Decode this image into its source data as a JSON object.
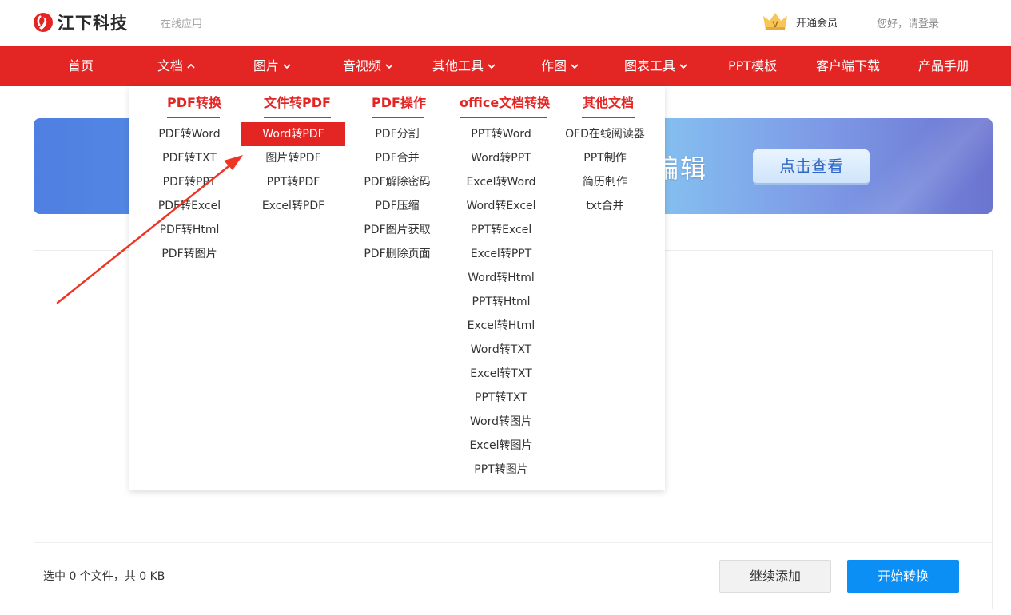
{
  "header": {
    "logo_text": "江下科技",
    "subtitle": "在线应用",
    "vip_label": "开通会员",
    "login_label": "您好，请登录"
  },
  "nav": {
    "items": [
      {
        "label": "首页"
      },
      {
        "label": "文档"
      },
      {
        "label": "图片"
      },
      {
        "label": "音视频"
      },
      {
        "label": "其他工具"
      },
      {
        "label": "作图"
      },
      {
        "label": "图表工具"
      },
      {
        "label": "PPT模板"
      },
      {
        "label": "客户端下载"
      },
      {
        "label": "产品手册"
      }
    ]
  },
  "banner": {
    "text": "编辑",
    "button": "点击查看"
  },
  "dropdown": {
    "columns": [
      {
        "title": "PDF转换",
        "items": [
          "PDF转Word",
          "PDF转TXT",
          "PDF转PPT",
          "PDF转Excel",
          "PDF转Html",
          "PDF转图片"
        ]
      },
      {
        "title": "文件转PDF",
        "items": [
          "Word转PDF",
          "图片转PDF",
          "PPT转PDF",
          "Excel转PDF"
        ]
      },
      {
        "title": "PDF操作",
        "items": [
          "PDF分割",
          "PDF合并",
          "PDF解除密码",
          "PDF压缩",
          "PDF图片获取",
          "PDF删除页面"
        ]
      },
      {
        "title": "office文档转换",
        "items": [
          "PPT转Word",
          "Word转PPT",
          "Excel转Word",
          "Word转Excel",
          "PPT转Excel",
          "Excel转PPT",
          "Word转Html",
          "PPT转Html",
          "Excel转Html",
          "Word转TXT",
          "Excel转TXT",
          "PPT转TXT",
          "Word转图片",
          "Excel转图片",
          "PPT转图片"
        ]
      },
      {
        "title": "其他文档",
        "items": [
          "OFD在线阅读器",
          "PPT制作",
          "简历制作",
          "txt合并"
        ]
      }
    ]
  },
  "upload": {
    "file_info": "选中 0 个文件，共 0 KB",
    "add_button": "继续添加",
    "start_button": "开始转换"
  },
  "colors": {
    "brand_red": "#e32523",
    "primary_blue": "#0c8ff5"
  }
}
